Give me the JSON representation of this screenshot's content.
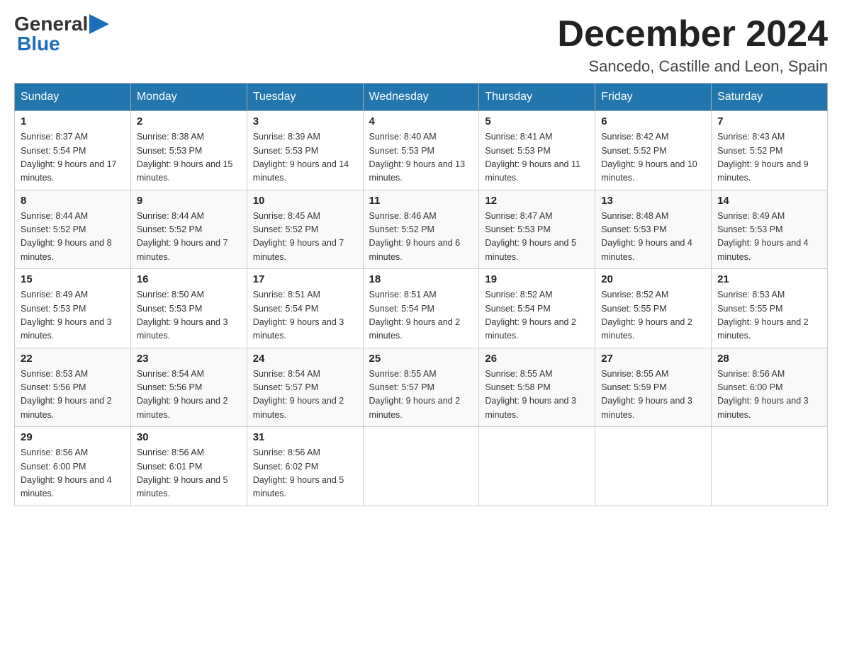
{
  "header": {
    "logo_general": "General",
    "logo_blue": "Blue",
    "month_title": "December 2024",
    "subtitle": "Sancedo, Castille and Leon, Spain"
  },
  "weekdays": [
    "Sunday",
    "Monday",
    "Tuesday",
    "Wednesday",
    "Thursday",
    "Friday",
    "Saturday"
  ],
  "weeks": [
    [
      {
        "day": "1",
        "sunrise": "8:37 AM",
        "sunset": "5:54 PM",
        "daylight": "9 hours and 17 minutes."
      },
      {
        "day": "2",
        "sunrise": "8:38 AM",
        "sunset": "5:53 PM",
        "daylight": "9 hours and 15 minutes."
      },
      {
        "day": "3",
        "sunrise": "8:39 AM",
        "sunset": "5:53 PM",
        "daylight": "9 hours and 14 minutes."
      },
      {
        "day": "4",
        "sunrise": "8:40 AM",
        "sunset": "5:53 PM",
        "daylight": "9 hours and 13 minutes."
      },
      {
        "day": "5",
        "sunrise": "8:41 AM",
        "sunset": "5:53 PM",
        "daylight": "9 hours and 11 minutes."
      },
      {
        "day": "6",
        "sunrise": "8:42 AM",
        "sunset": "5:52 PM",
        "daylight": "9 hours and 10 minutes."
      },
      {
        "day": "7",
        "sunrise": "8:43 AM",
        "sunset": "5:52 PM",
        "daylight": "9 hours and 9 minutes."
      }
    ],
    [
      {
        "day": "8",
        "sunrise": "8:44 AM",
        "sunset": "5:52 PM",
        "daylight": "9 hours and 8 minutes."
      },
      {
        "day": "9",
        "sunrise": "8:44 AM",
        "sunset": "5:52 PM",
        "daylight": "9 hours and 7 minutes."
      },
      {
        "day": "10",
        "sunrise": "8:45 AM",
        "sunset": "5:52 PM",
        "daylight": "9 hours and 7 minutes."
      },
      {
        "day": "11",
        "sunrise": "8:46 AM",
        "sunset": "5:52 PM",
        "daylight": "9 hours and 6 minutes."
      },
      {
        "day": "12",
        "sunrise": "8:47 AM",
        "sunset": "5:53 PM",
        "daylight": "9 hours and 5 minutes."
      },
      {
        "day": "13",
        "sunrise": "8:48 AM",
        "sunset": "5:53 PM",
        "daylight": "9 hours and 4 minutes."
      },
      {
        "day": "14",
        "sunrise": "8:49 AM",
        "sunset": "5:53 PM",
        "daylight": "9 hours and 4 minutes."
      }
    ],
    [
      {
        "day": "15",
        "sunrise": "8:49 AM",
        "sunset": "5:53 PM",
        "daylight": "9 hours and 3 minutes."
      },
      {
        "day": "16",
        "sunrise": "8:50 AM",
        "sunset": "5:53 PM",
        "daylight": "9 hours and 3 minutes."
      },
      {
        "day": "17",
        "sunrise": "8:51 AM",
        "sunset": "5:54 PM",
        "daylight": "9 hours and 3 minutes."
      },
      {
        "day": "18",
        "sunrise": "8:51 AM",
        "sunset": "5:54 PM",
        "daylight": "9 hours and 2 minutes."
      },
      {
        "day": "19",
        "sunrise": "8:52 AM",
        "sunset": "5:54 PM",
        "daylight": "9 hours and 2 minutes."
      },
      {
        "day": "20",
        "sunrise": "8:52 AM",
        "sunset": "5:55 PM",
        "daylight": "9 hours and 2 minutes."
      },
      {
        "day": "21",
        "sunrise": "8:53 AM",
        "sunset": "5:55 PM",
        "daylight": "9 hours and 2 minutes."
      }
    ],
    [
      {
        "day": "22",
        "sunrise": "8:53 AM",
        "sunset": "5:56 PM",
        "daylight": "9 hours and 2 minutes."
      },
      {
        "day": "23",
        "sunrise": "8:54 AM",
        "sunset": "5:56 PM",
        "daylight": "9 hours and 2 minutes."
      },
      {
        "day": "24",
        "sunrise": "8:54 AM",
        "sunset": "5:57 PM",
        "daylight": "9 hours and 2 minutes."
      },
      {
        "day": "25",
        "sunrise": "8:55 AM",
        "sunset": "5:57 PM",
        "daylight": "9 hours and 2 minutes."
      },
      {
        "day": "26",
        "sunrise": "8:55 AM",
        "sunset": "5:58 PM",
        "daylight": "9 hours and 3 minutes."
      },
      {
        "day": "27",
        "sunrise": "8:55 AM",
        "sunset": "5:59 PM",
        "daylight": "9 hours and 3 minutes."
      },
      {
        "day": "28",
        "sunrise": "8:56 AM",
        "sunset": "6:00 PM",
        "daylight": "9 hours and 3 minutes."
      }
    ],
    [
      {
        "day": "29",
        "sunrise": "8:56 AM",
        "sunset": "6:00 PM",
        "daylight": "9 hours and 4 minutes."
      },
      {
        "day": "30",
        "sunrise": "8:56 AM",
        "sunset": "6:01 PM",
        "daylight": "9 hours and 5 minutes."
      },
      {
        "day": "31",
        "sunrise": "8:56 AM",
        "sunset": "6:02 PM",
        "daylight": "9 hours and 5 minutes."
      },
      null,
      null,
      null,
      null
    ]
  ]
}
